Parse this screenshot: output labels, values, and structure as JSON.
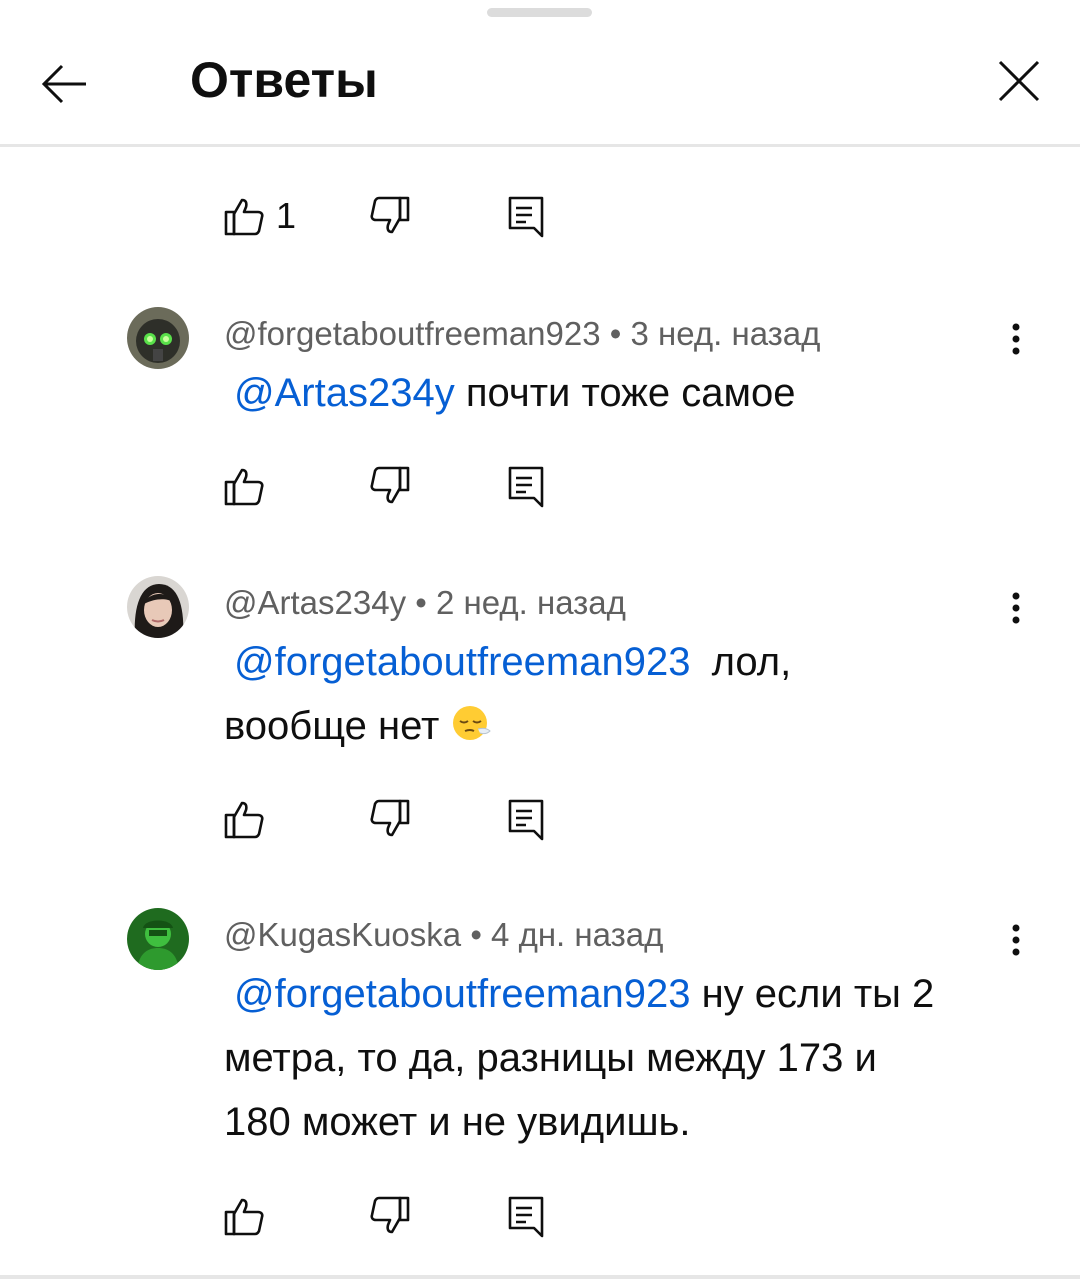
{
  "header": {
    "title": "Ответы",
    "back_icon": "arrow-left-icon",
    "close_icon": "close-icon"
  },
  "parent_actions": {
    "like_count": "1"
  },
  "comments": [
    {
      "author": "@forgetaboutfreeman923",
      "separator": "•",
      "time": "3 нед. назад",
      "mention": "@Artas234y",
      "text": "почти тоже самое"
    },
    {
      "author": "@Artas234y",
      "separator": "•",
      "time": "2 нед. назад",
      "mention": "@forgetaboutfreeman923",
      "text_line1": "лол,",
      "text_line2": "вообще нет",
      "emoji": "sleepy-face-emoji"
    },
    {
      "author": "@KugasKuoska",
      "separator": "•",
      "time": "4 дн. назад",
      "mention": "@forgetaboutfreeman923",
      "text_line1": "ну если ты 2",
      "text_line2": "метра, то да, разницы между 173 и",
      "text_line3": "180 может и не увидишь."
    }
  ],
  "colors": {
    "mention": "#065fd4",
    "meta": "#606060",
    "text": "#0f0f0f",
    "divider": "#e6e6e6"
  }
}
